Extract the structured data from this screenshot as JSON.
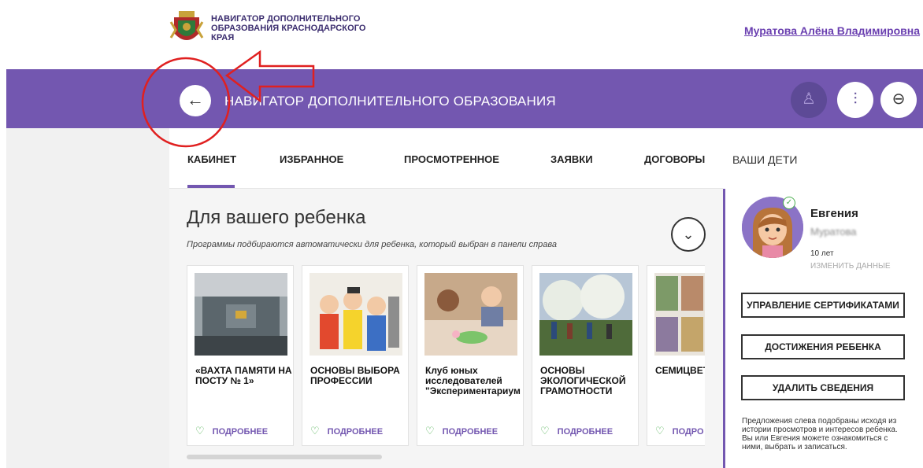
{
  "header": {
    "brand_text": "НАВИГАТОР ДОПОЛНИТЕЛЬНОГО ОБРАЗОВАНИЯ КРАСНОДАРСКОГО КРАЯ",
    "user_name": "Муратова Алёна Владимировна"
  },
  "band": {
    "back_icon": "arrow-left-icon",
    "back_glyph": "←",
    "title": "НАВИГАТОР ДОПОЛНИТЕЛЬНОГО ОБРАЗОВАНИЯ",
    "profile_glyph": "♙",
    "settings_glyph": "⫶",
    "logout_glyph": "⊖",
    "accent_color": "#7357b0"
  },
  "tabs": [
    {
      "label": "КАБИНЕТ",
      "active": true
    },
    {
      "label": "ИЗБРАННОЕ"
    },
    {
      "label": "ПРОСМОТРЕННОЕ"
    },
    {
      "label": "ЗАЯВКИ"
    },
    {
      "label": "ДОГОВОРЫ"
    }
  ],
  "recommendations": {
    "title": "Для вашего ребенка",
    "subtitle": "Программы подбираются автоматически для ребенка, который выбран в панели справа",
    "collapse_glyph": "⌄",
    "cards": [
      {
        "title": "«ВАХТА ПАМЯТИ НА ПОСТУ № 1»",
        "more": "ПОДРОБНЕЕ"
      },
      {
        "title": "ОСНОВЫ ВЫБОРА ПРОФЕССИИ",
        "more": "ПОДРОБНЕЕ"
      },
      {
        "title": "Клуб юных исследователей \"Экспериментариум",
        "more": "ПОДРОБНЕЕ"
      },
      {
        "title": "ОСНОВЫ ЭКОЛОГИЧЕСКОЙ ГРАМОТНОСТИ",
        "more": "ПОДРОБНЕЕ"
      },
      {
        "title": "СЕМИЦВЕТІ",
        "more": "ПОДРО"
      }
    ],
    "heart_glyph": "♡"
  },
  "children": {
    "heading": "ВАШИ ДЕТИ",
    "name": "Евгения",
    "surname": "Муратова",
    "age": "10 лет",
    "edit_label": "ИЗМЕНИТЬ ДАННЫЕ",
    "buttons": [
      "УПРАВЛЕНИЕ СЕРТИФИКАТАМИ",
      "ДОСТИЖЕНИЯ РЕБЕНКА",
      "УДАЛИТЬ СВЕДЕНИЯ"
    ],
    "note": "Предложения слева подобраны исходя из истории просмотров и интересов ребенка. Вы или Евгения можете ознакомиться с ними, выбрать и записаться."
  }
}
